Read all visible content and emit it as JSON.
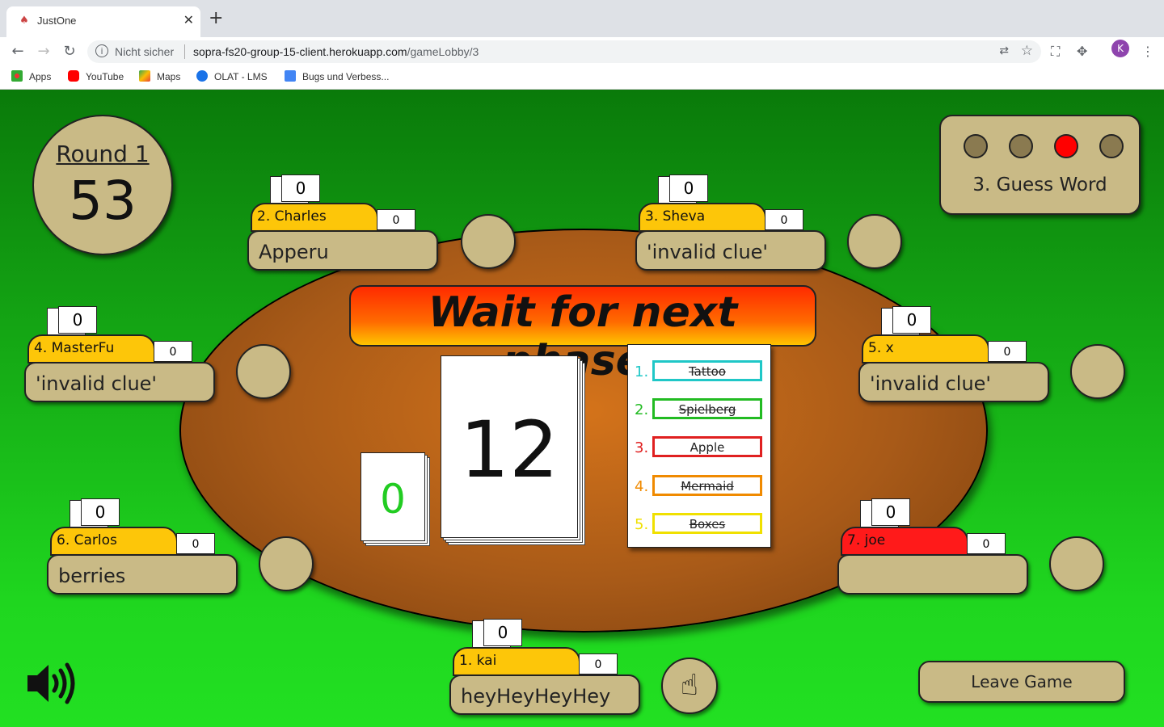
{
  "browser": {
    "tab_title": "JustOne",
    "url_security": "Nicht sicher",
    "url_host": "sopra-fs20-group-15-client.herokuapp.com",
    "url_path": "/gameLobby/3",
    "profile_initial": "K",
    "bookmarks": [
      "Apps",
      "YouTube",
      "Maps",
      "OLAT - LMS",
      "Bugs und Verbess..."
    ]
  },
  "game": {
    "round_label": "Round 1",
    "timer": "53",
    "phase_label": "3. Guess Word",
    "phase_dots": 4,
    "active_phase_index": 2,
    "banner": "Wait for next phase!",
    "small_card_value": "0",
    "deck_count": "12",
    "words": [
      {
        "num": "1.",
        "word": "Tattoo",
        "color": "#1fc7c7",
        "struck": true
      },
      {
        "num": "2.",
        "word": "Spielberg",
        "color": "#22bb22",
        "struck": true
      },
      {
        "num": "3.",
        "word": "Apple",
        "color": "#e02020",
        "struck": false
      },
      {
        "num": "4.",
        "word": "Mermaid",
        "color": "#f08a00",
        "struck": true
      },
      {
        "num": "5.",
        "word": "Boxes",
        "color": "#f0e000",
        "struck": true
      }
    ],
    "players": [
      {
        "name": "2. Charles",
        "score": "0",
        "small_score": "0",
        "clue": "Apperu",
        "color": "yellow"
      },
      {
        "name": "3. Sheva",
        "score": "0",
        "small_score": "0",
        "clue": "'invalid clue'",
        "color": "yellow"
      },
      {
        "name": "4. MasterFu",
        "score": "0",
        "small_score": "0",
        "clue": "'invalid clue'",
        "color": "yellow"
      },
      {
        "name": "5. x",
        "score": "0",
        "small_score": "0",
        "clue": "'invalid clue'",
        "color": "yellow"
      },
      {
        "name": "6. Carlos",
        "score": "0",
        "small_score": "0",
        "clue": "berries",
        "color": "yellow"
      },
      {
        "name": "7. joe",
        "score": "0",
        "small_score": "0",
        "clue": "",
        "color": "red"
      },
      {
        "name": "1. kai",
        "score": "0",
        "small_score": "0",
        "clue": "heyHeyHeyHey",
        "color": "yellow"
      }
    ],
    "leave_label": "Leave Game"
  }
}
